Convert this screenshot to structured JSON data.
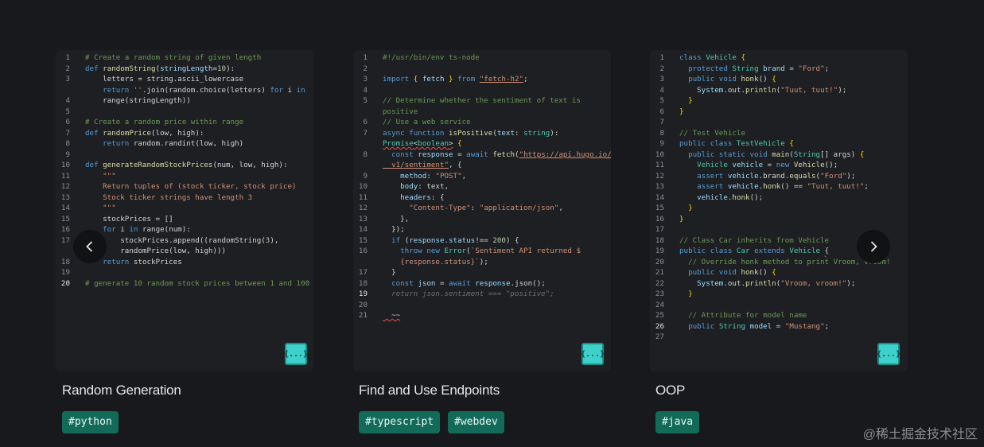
{
  "cards": [
    {
      "title": "Random Generation",
      "tags": [
        "#python"
      ],
      "icon_label": "{...}",
      "code": [
        [
          [
            "c",
            "# Create a random string of given length"
          ]
        ],
        [
          [
            "k",
            "def "
          ],
          [
            "f",
            "randomString"
          ],
          [
            "",
            "("
          ],
          [
            "p",
            "stringLength"
          ],
          [
            "",
            "="
          ],
          [
            "n",
            "10"
          ],
          [
            "",
            "):"
          ]
        ],
        [
          [
            "",
            "    letters = string.ascii_lowercase"
          ]
        ],
        [
          [
            "",
            "    "
          ],
          [
            "k",
            "return "
          ],
          [
            "s",
            "''"
          ],
          [
            "",
            ".join(random.choice(letters) "
          ],
          [
            "k",
            "for "
          ],
          [
            "",
            "i "
          ],
          [
            "k",
            "in"
          ]
        ],
        [
          [
            "",
            "    range(stringLength))"
          ]
        ],
        [],
        [
          [
            "c",
            "# Create a random price within range"
          ]
        ],
        [
          [
            "k",
            "def "
          ],
          [
            "f",
            "randomPrice"
          ],
          [
            "",
            "(low, high):"
          ]
        ],
        [
          [
            "",
            "    "
          ],
          [
            "k",
            "return "
          ],
          [
            "",
            "random.randint(low, high)"
          ]
        ],
        [],
        [
          [
            "k",
            "def "
          ],
          [
            "f",
            "generateRandomStockPrices"
          ],
          [
            "",
            "(num, low, high):"
          ]
        ],
        [
          [
            "s",
            "    \"\"\""
          ]
        ],
        [
          [
            "s",
            "    Return tuples of (stock ticker, stock price)"
          ]
        ],
        [
          [
            "s",
            "    Stock ticker strings have length 3"
          ]
        ],
        [
          [
            "s",
            "    \"\"\""
          ]
        ],
        [
          [
            "",
            "    stockPrices = []"
          ]
        ],
        [
          [
            "",
            "    "
          ],
          [
            "k",
            "for "
          ],
          [
            "",
            "i "
          ],
          [
            "k",
            "in "
          ],
          [
            "",
            "range(num):"
          ]
        ],
        [
          [
            "",
            "        stockPrices.append((randomString("
          ],
          [
            "n",
            "3"
          ],
          [
            "",
            "),"
          ]
        ],
        [
          [
            "",
            "        randomPrice(low, high)))"
          ]
        ],
        [
          [
            "",
            "    "
          ],
          [
            "k",
            "return "
          ],
          [
            "",
            "stockPrices"
          ]
        ],
        [],
        [
          [
            "c",
            "# generate 10 random stock prices between 1 and 100"
          ]
        ]
      ],
      "numbers": [
        "1",
        "2",
        "3",
        "",
        "4",
        "5",
        "6",
        "7",
        "8",
        "9",
        "10",
        "11",
        "12",
        "13",
        "14",
        "15",
        "16",
        "17",
        "",
        "18",
        "19",
        "20"
      ]
    },
    {
      "title": "Find and Use Endpoints",
      "tags": [
        "#typescript",
        "#webdev"
      ],
      "icon_label": "{...}",
      "code": [
        [
          [
            "c",
            "#!/usr/bin/env ts-node"
          ]
        ],
        [],
        [
          [
            "k",
            "import "
          ],
          [
            "y",
            "{ "
          ],
          [
            "p",
            "fetch"
          ],
          [
            "y",
            " } "
          ],
          [
            "k",
            "from "
          ],
          [
            "su",
            "\"fetch-h2\""
          ],
          [
            "",
            ";"
          ]
        ],
        [],
        [
          [
            "c",
            "// Determine whether the sentiment of text is"
          ]
        ],
        [
          [
            "c",
            "positive"
          ]
        ],
        [
          [
            "c",
            "// Use a web service"
          ]
        ],
        [
          [
            "k",
            "async function "
          ],
          [
            "f",
            "isPositive"
          ],
          [
            "",
            "("
          ],
          [
            "p",
            "text"
          ],
          [
            "",
            ": "
          ],
          [
            "t",
            "string"
          ],
          [
            "",
            "):"
          ]
        ],
        [
          [
            "tw",
            "Promise"
          ],
          [
            "w",
            "<"
          ],
          [
            "tw",
            "boolean"
          ],
          [
            "w",
            ">"
          ],
          [
            "y",
            " {"
          ]
        ],
        [
          [
            "",
            "  "
          ],
          [
            "k",
            "const "
          ],
          [
            "p",
            "response "
          ],
          [
            "",
            "= "
          ],
          [
            "k",
            "await "
          ],
          [
            "f",
            "fetch"
          ],
          [
            "",
            "("
          ],
          [
            "su",
            "\"https://api.hugo.io/"
          ]
        ],
        [
          [
            "su",
            "  v1/sentiment\""
          ],
          [
            "",
            ", {"
          ]
        ],
        [
          [
            "",
            "    "
          ],
          [
            "p",
            "method"
          ],
          [
            "",
            ": "
          ],
          [
            "s",
            "\"POST\""
          ],
          [
            "",
            ","
          ]
        ],
        [
          [
            "",
            "    "
          ],
          [
            "p",
            "body"
          ],
          [
            "",
            ": text,"
          ]
        ],
        [
          [
            "",
            "    "
          ],
          [
            "p",
            "headers"
          ],
          [
            "",
            ": {"
          ]
        ],
        [
          [
            "",
            "      "
          ],
          [
            "s",
            "\"Content-Type\""
          ],
          [
            "",
            ": "
          ],
          [
            "s",
            "\"application/json\""
          ],
          [
            "",
            ","
          ]
        ],
        [
          [
            "",
            "    },"
          ]
        ],
        [
          [
            "",
            "  });"
          ]
        ],
        [
          [
            "",
            "  "
          ],
          [
            "k",
            "if "
          ],
          [
            "",
            "("
          ],
          [
            "p",
            "response.status"
          ],
          [
            "",
            "!== "
          ],
          [
            "n",
            "200"
          ],
          [
            "",
            ") {"
          ]
        ],
        [
          [
            "",
            "    "
          ],
          [
            "k",
            "throw new "
          ],
          [
            "t",
            "Error"
          ],
          [
            "",
            "("
          ],
          [
            "s",
            "`Sentiment API returned $"
          ]
        ],
        [
          [
            "s",
            "    {response.status}`"
          ],
          [
            "",
            ");"
          ]
        ],
        [
          [
            "",
            "  }"
          ]
        ],
        [
          [
            "",
            "  "
          ],
          [
            "k",
            "const "
          ],
          [
            "p",
            "json "
          ],
          [
            "",
            "= "
          ],
          [
            "k",
            "await "
          ],
          [
            "p",
            "response"
          ],
          [
            "",
            ".json();"
          ]
        ],
        [
          [
            "g",
            "  return json.sentiment === \"positive\";"
          ]
        ],
        [],
        [
          [
            "w",
            "  ~~"
          ]
        ]
      ],
      "numbers": [
        "1",
        "2",
        "3",
        "4",
        "5",
        "",
        "6",
        "7",
        "",
        "8",
        "",
        "9",
        "10",
        "11",
        "12",
        "13",
        "14",
        "15",
        "16",
        "",
        "17",
        "18",
        "19",
        "20",
        "21"
      ]
    },
    {
      "title": "OOP",
      "tags": [
        "#java"
      ],
      "icon_label": "{...}",
      "code": [
        [
          [
            "k",
            "class "
          ],
          [
            "t",
            "Vehicle "
          ],
          [
            "y",
            "{"
          ]
        ],
        [
          [
            "",
            "  "
          ],
          [
            "k",
            "protected "
          ],
          [
            "t",
            "String "
          ],
          [
            "p",
            "brand "
          ],
          [
            "",
            "= "
          ],
          [
            "s",
            "\"Ford\""
          ],
          [
            "",
            ";"
          ]
        ],
        [
          [
            "",
            "  "
          ],
          [
            "k",
            "public void "
          ],
          [
            "f",
            "honk"
          ],
          [
            "",
            "() "
          ],
          [
            "y",
            "{"
          ]
        ],
        [
          [
            "",
            "    "
          ],
          [
            "p",
            "System"
          ],
          [
            "",
            ".out."
          ],
          [
            "f",
            "println"
          ],
          [
            "",
            "("
          ],
          [
            "s",
            "\"Tuut, tuut!\""
          ],
          [
            "",
            ");"
          ]
        ],
        [
          [
            "",
            "  "
          ],
          [
            "y",
            "}"
          ]
        ],
        [
          [
            "y",
            "}"
          ]
        ],
        [],
        [
          [
            "c",
            "// Test Vehicle"
          ]
        ],
        [
          [
            "k",
            "public class "
          ],
          [
            "t",
            "TestVehicle "
          ],
          [
            "y",
            "{"
          ]
        ],
        [
          [
            "",
            "  "
          ],
          [
            "k",
            "public static void "
          ],
          [
            "f",
            "main"
          ],
          [
            "",
            "("
          ],
          [
            "t",
            "String"
          ],
          [
            "",
            "[] args) "
          ],
          [
            "y",
            "{"
          ]
        ],
        [
          [
            "",
            "    "
          ],
          [
            "t",
            "Vehicle "
          ],
          [
            "p",
            "vehicle "
          ],
          [
            "",
            "= "
          ],
          [
            "k",
            "new "
          ],
          [
            "f",
            "Vehicle"
          ],
          [
            "",
            "();"
          ]
        ],
        [
          [
            "",
            "    "
          ],
          [
            "k",
            "assert "
          ],
          [
            "p",
            "vehicle"
          ],
          [
            "",
            ".brand."
          ],
          [
            "f",
            "equals"
          ],
          [
            "",
            "("
          ],
          [
            "s",
            "\"Ford\""
          ],
          [
            "",
            ");"
          ]
        ],
        [
          [
            "",
            "    "
          ],
          [
            "k",
            "assert "
          ],
          [
            "p",
            "vehicle"
          ],
          [
            "",
            "."
          ],
          [
            "f",
            "honk"
          ],
          [
            "",
            "() == "
          ],
          [
            "s",
            "\"Tuut, tuut!\""
          ],
          [
            "",
            ";"
          ]
        ],
        [
          [
            "",
            "    "
          ],
          [
            "p",
            "vehicle"
          ],
          [
            "",
            "."
          ],
          [
            "f",
            "honk"
          ],
          [
            "",
            "();"
          ]
        ],
        [
          [
            "",
            "  "
          ],
          [
            "y",
            "}"
          ]
        ],
        [
          [
            "y",
            "}"
          ]
        ],
        [],
        [
          [
            "c",
            "// Class Car inherits from Vehicle"
          ]
        ],
        [
          [
            "k",
            "public class "
          ],
          [
            "t",
            "Car "
          ],
          [
            "k",
            "extends "
          ],
          [
            "t",
            "Vehicle "
          ],
          [
            "w",
            "{"
          ]
        ],
        [
          [
            "c",
            "  // Override honk method to print Vroom, vroom!"
          ]
        ],
        [
          [
            "",
            "  "
          ],
          [
            "k",
            "public void "
          ],
          [
            "f",
            "honk"
          ],
          [
            "",
            "() "
          ],
          [
            "y",
            "{"
          ]
        ],
        [
          [
            "",
            "    "
          ],
          [
            "p",
            "System"
          ],
          [
            "",
            ".out."
          ],
          [
            "f",
            "println"
          ],
          [
            "",
            "("
          ],
          [
            "s",
            "\"Vroom, vroom!\""
          ],
          [
            "",
            ");"
          ]
        ],
        [
          [
            "",
            "  "
          ],
          [
            "y",
            "}"
          ]
        ],
        [],
        [
          [
            "c",
            "  // Attribute for model name"
          ]
        ],
        [
          [
            "",
            "  "
          ],
          [
            "k",
            "public "
          ],
          [
            "t",
            "String "
          ],
          [
            "p",
            "model "
          ],
          [
            "",
            "= "
          ],
          [
            "s",
            "\"Mustang\""
          ],
          [
            "",
            ";"
          ]
        ],
        []
      ],
      "numbers": [
        "1",
        "2",
        "3",
        "4",
        "5",
        "6",
        "7",
        "8",
        "9",
        "10",
        "11",
        "12",
        "13",
        "14",
        "15",
        "16",
        "17",
        "18",
        "19",
        "20",
        "21",
        "22",
        "23",
        "24",
        "25",
        "26",
        "27"
      ]
    }
  ],
  "nav": {
    "prev_label": "‹",
    "next_label": "›"
  },
  "watermark": "@稀土掘金技术社区"
}
